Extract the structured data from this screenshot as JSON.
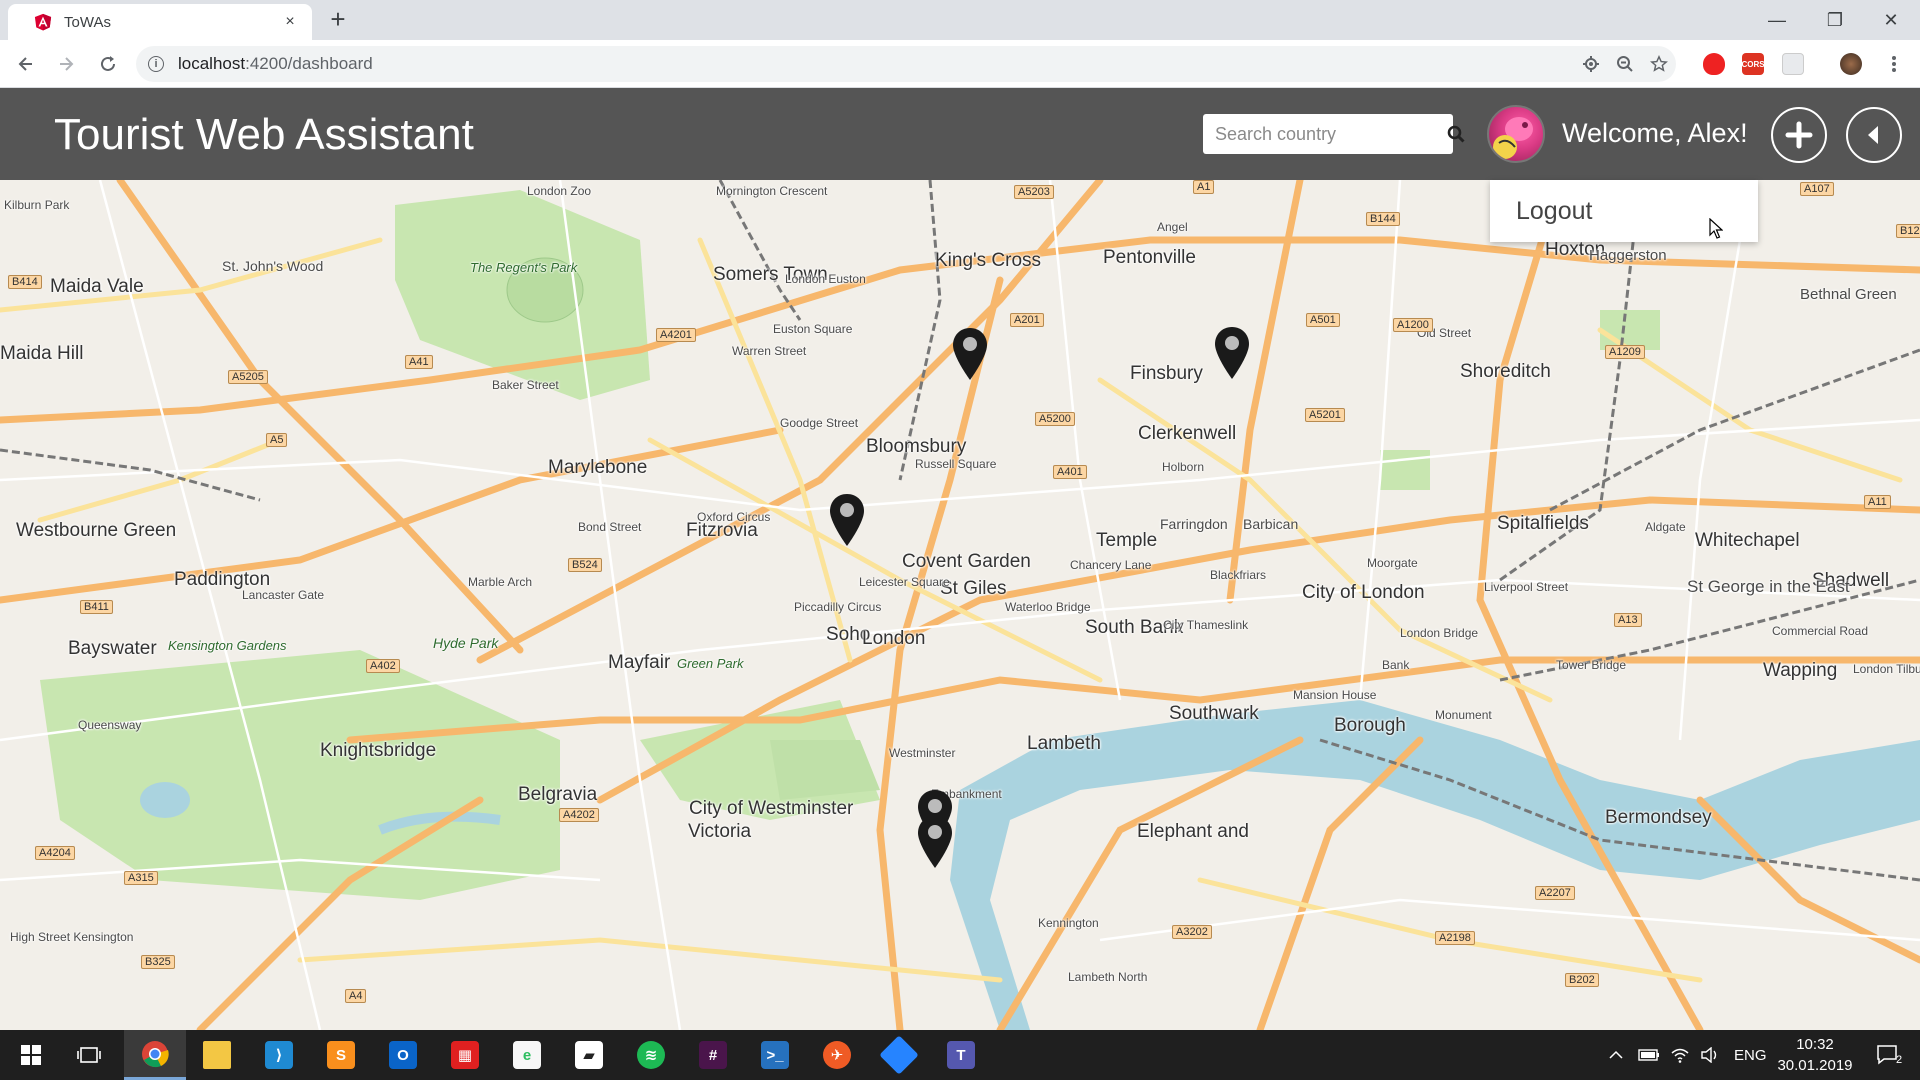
{
  "browser": {
    "tab_title": "ToWAs",
    "tab_close": "×",
    "new_tab": "+",
    "url_host": "localhost",
    "url_path": ":4200/dashboard",
    "win_minimize": "—",
    "win_restore": "❐",
    "win_close": "✕",
    "extension_badge": "CORS"
  },
  "app": {
    "brand": "Tourist Web Assistant",
    "search": {
      "placeholder": "Search country",
      "value": ""
    },
    "welcome": "Welcome, Alex!",
    "dropdown": {
      "logout_label": "Logout"
    }
  },
  "map": {
    "labels": [
      {
        "text": "London Zoo"
      },
      {
        "text": "The Regent's Park"
      },
      {
        "text": "St. John's Wood"
      },
      {
        "text": "Kilburn Park"
      },
      {
        "text": "Maida Vale"
      },
      {
        "text": "Marylebone"
      },
      {
        "text": "Somers Town"
      },
      {
        "text": "King's Cross"
      },
      {
        "text": "Pentonville"
      },
      {
        "text": "Hoxton"
      },
      {
        "text": "Haggerston"
      },
      {
        "text": "Bethnal Green"
      },
      {
        "text": "Bloomsbury"
      },
      {
        "text": "Clerkenwell"
      },
      {
        "text": "Finsbury"
      },
      {
        "text": "Shoreditch"
      },
      {
        "text": "Fitzrovia"
      },
      {
        "text": "St Giles"
      },
      {
        "text": "Farringdon"
      },
      {
        "text": "Barbican"
      },
      {
        "text": "Spitalfields"
      },
      {
        "text": "Whitechapel"
      },
      {
        "text": "City of London"
      },
      {
        "text": "Paddington"
      },
      {
        "text": "Westbourne Green"
      },
      {
        "text": "Bayswater"
      },
      {
        "text": "Soho"
      },
      {
        "text": "Mayfair"
      },
      {
        "text": "Covent Garden"
      },
      {
        "text": "Temple"
      },
      {
        "text": "London"
      },
      {
        "text": "South Bank"
      },
      {
        "text": "Hyde Park"
      },
      {
        "text": "Kensington Gardens"
      },
      {
        "text": "Green Park"
      },
      {
        "text": "Lambeth"
      },
      {
        "text": "Southwark"
      },
      {
        "text": "Borough"
      },
      {
        "text": "Bermondsey"
      },
      {
        "text": "Knightsbridge"
      },
      {
        "text": "Belgravia"
      },
      {
        "text": "City of Westminster"
      },
      {
        "text": "Victoria"
      },
      {
        "text": "Wapping"
      },
      {
        "text": "Shadwell"
      },
      {
        "text": "St George in the East"
      },
      {
        "text": "Elephant and"
      },
      {
        "text": "Westminster"
      },
      {
        "text": "Tower Bridge"
      },
      {
        "text": "London Bridge"
      },
      {
        "text": "Blackfriars"
      },
      {
        "text": "Waterloo Bridge"
      },
      {
        "text": "Aldgate"
      },
      {
        "text": "Holborn"
      },
      {
        "text": "Euston Square"
      },
      {
        "text": "London Euston"
      },
      {
        "text": "Warren Street"
      },
      {
        "text": "Baker Street"
      },
      {
        "text": "Goodge Street"
      },
      {
        "text": "Oxford Circus"
      },
      {
        "text": "Bond Street"
      },
      {
        "text": "Piccadilly Circus"
      },
      {
        "text": "Leicester Square"
      },
      {
        "text": "Russell Square"
      },
      {
        "text": "Old Street"
      },
      {
        "text": "Angel"
      },
      {
        "text": "Mornington Crescent"
      },
      {
        "text": "Lancaster Gate"
      },
      {
        "text": "Marble Arch"
      },
      {
        "text": "Queensway"
      },
      {
        "text": "High Street Kensington"
      },
      {
        "text": "Kennington"
      },
      {
        "text": "Bank"
      },
      {
        "text": "Monument"
      },
      {
        "text": "Mansion House"
      },
      {
        "text": "Chancery Lane"
      },
      {
        "text": "Moorgate"
      },
      {
        "text": "Liverpool Street"
      },
      {
        "text": "City Thameslink"
      },
      {
        "text": "Embankment"
      },
      {
        "text": "Lambeth North"
      },
      {
        "text": "Maida Hill"
      }
    ],
    "roads": [
      "A5203",
      "A1",
      "B144",
      "A107",
      "B12",
      "B414",
      "A4201",
      "A41",
      "A5205",
      "A5",
      "A201",
      "A5200",
      "A501",
      "A1200",
      "A1209",
      "A5201",
      "A401",
      "A11",
      "B524",
      "B411",
      "A402",
      "A13",
      "A4202",
      "A4204",
      "A315",
      "A3202",
      "A2198",
      "A2207",
      "B202",
      "B325",
      "A4",
      "Commercial Road",
      "London Tilbury"
    ],
    "markers": [
      {
        "name": "Kings Cross area"
      },
      {
        "name": "Angel area"
      },
      {
        "name": "Goodge Street area"
      },
      {
        "name": "Westminster top"
      },
      {
        "name": "Westminster bottom"
      }
    ]
  },
  "taskbar": {
    "language": "ENG",
    "time": "10:32",
    "date": "30.01.2019",
    "notification_count": "2",
    "apps": [
      "windows-start",
      "task-view",
      "chrome",
      "file-explorer",
      "vscode",
      "sublime-text",
      "outlook",
      "unknown-red",
      "evernote",
      "sticky",
      "spotify",
      "slack",
      "powershell",
      "postman",
      "sourcetree",
      "teams"
    ]
  }
}
